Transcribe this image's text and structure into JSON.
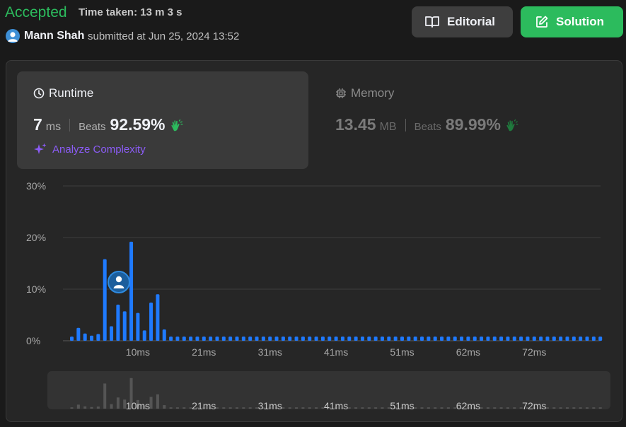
{
  "header": {
    "status": "Accepted",
    "time_taken": "Time taken: 13 m 3 s",
    "username": "Mann Shah",
    "submitted": "submitted at Jun 25, 2024 13:52",
    "editorial_label": "Editorial",
    "solution_label": "Solution"
  },
  "runtime": {
    "title": "Runtime",
    "value": "7",
    "unit": "ms",
    "beats_label": "Beats",
    "beats_pct": "92.59%",
    "analyze_label": "Analyze Complexity"
  },
  "memory": {
    "title": "Memory",
    "value": "13.45",
    "unit": "MB",
    "beats_label": "Beats",
    "beats_pct": "89.99%"
  },
  "colors": {
    "accepted": "#2cbb5d",
    "bar": "#1f7aff",
    "analyze": "#8b5cf6",
    "navigator_bar": "#555555"
  },
  "chart_data": {
    "type": "bar",
    "yticks": [
      "30%",
      "20%",
      "10%",
      "0%"
    ],
    "ylim": [
      0,
      30
    ],
    "x_tick_labels": [
      "10ms",
      "21ms",
      "31ms",
      "41ms",
      "51ms",
      "62ms",
      "72ms"
    ],
    "x_tick_indices": [
      10,
      20,
      30,
      40,
      50,
      60,
      70
    ],
    "user_bar_index": 7,
    "values": [
      0.8,
      2.5,
      1.4,
      1.0,
      1.3,
      15.8,
      2.8,
      7.0,
      5.7,
      19.2,
      5.4,
      2.0,
      7.4,
      9.0,
      2.2,
      0.8,
      0.8,
      0.8,
      0.8,
      0.8,
      0.8,
      0.8,
      0.8,
      0.8,
      0.8,
      0.8,
      0.8,
      0.8,
      0.8,
      0.8,
      0.8,
      0.8,
      0.8,
      0.8,
      0.8,
      0.8,
      0.8,
      0.8,
      0.8,
      0.8,
      0.8,
      0.8,
      0.8,
      0.8,
      0.8,
      0.8,
      0.8,
      0.8,
      0.8,
      0.8,
      0.8,
      0.8,
      0.8,
      0.8,
      0.8,
      0.8,
      0.8,
      0.8,
      0.8,
      0.8,
      0.8,
      0.8,
      0.8,
      0.8,
      0.8,
      0.8,
      0.8,
      0.8,
      0.8,
      0.8,
      0.8,
      0.8,
      0.8,
      0.8,
      0.8,
      0.8,
      0.8,
      0.8,
      0.8,
      0.8,
      0.8
    ]
  }
}
